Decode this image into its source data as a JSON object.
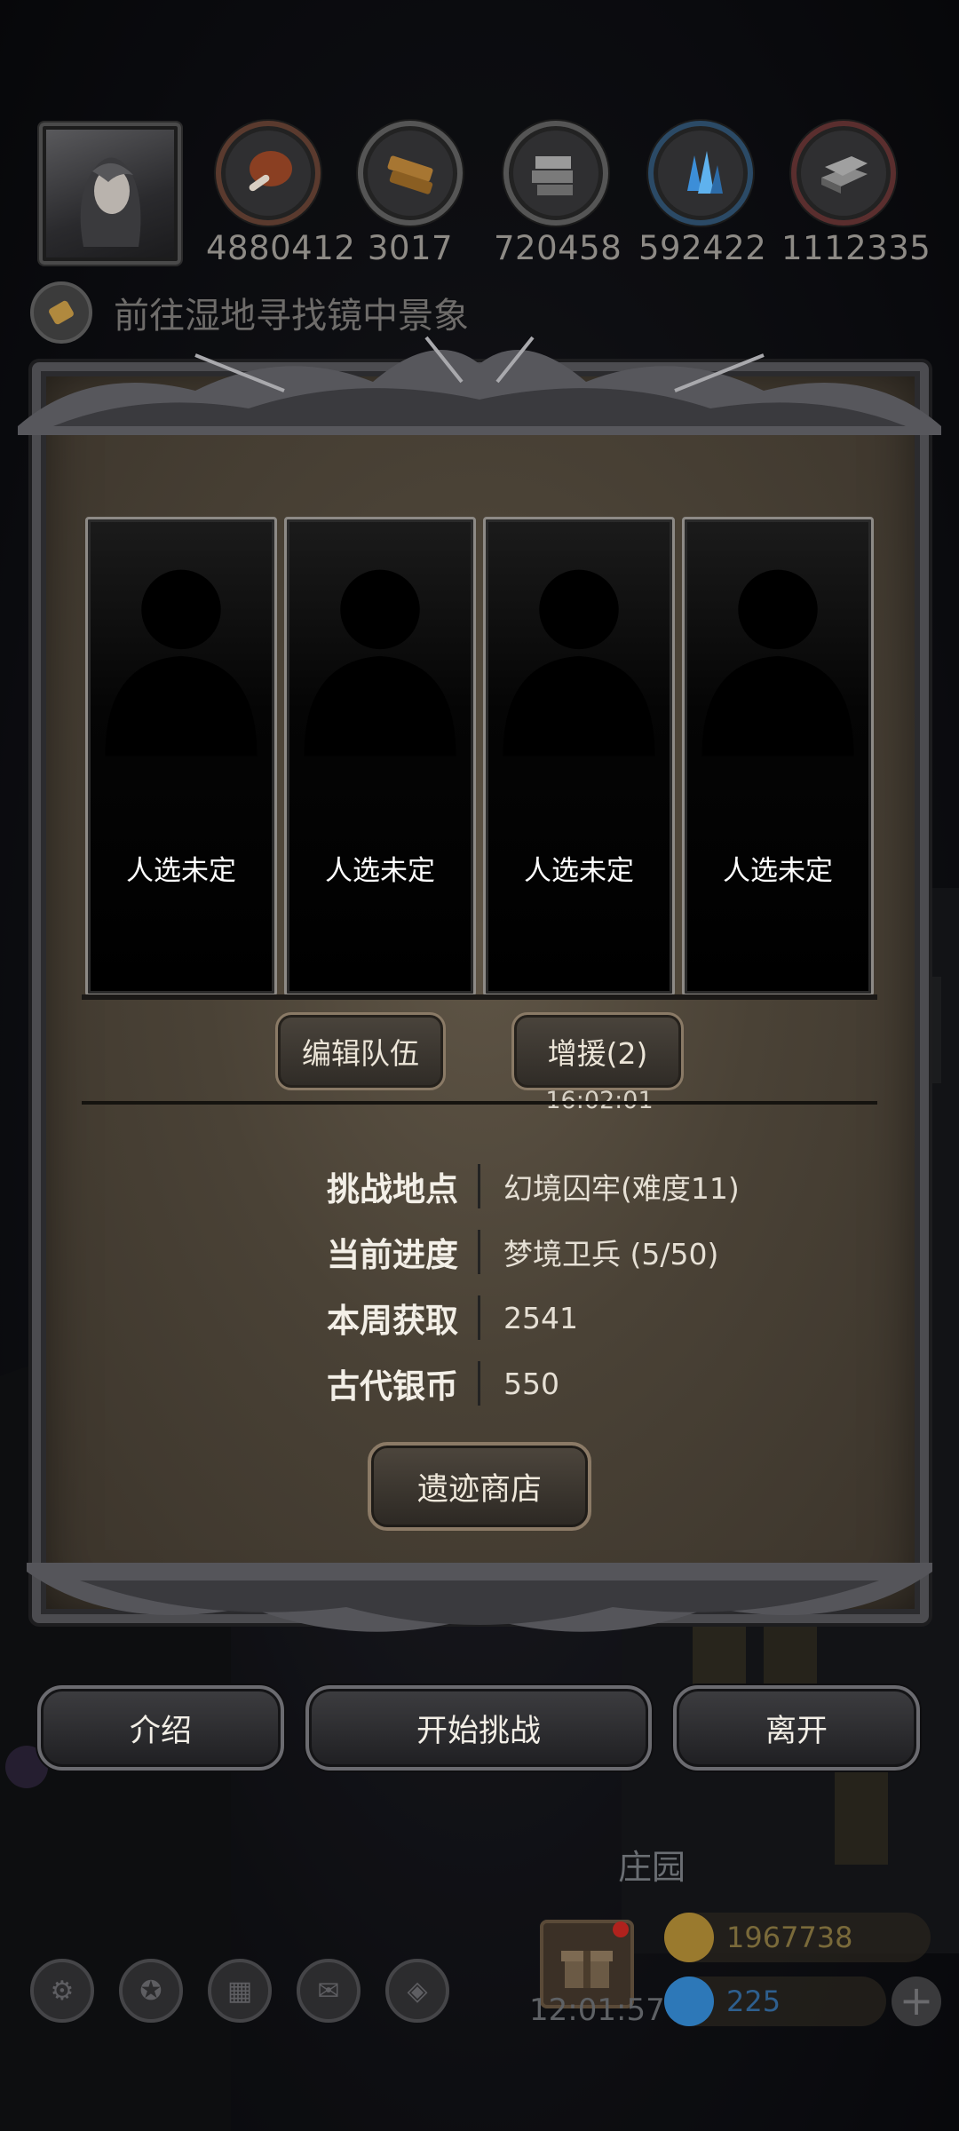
{
  "resources": [
    {
      "icon": "meat-icon",
      "value": "4880412"
    },
    {
      "icon": "wood-icon",
      "value": "3017"
    },
    {
      "icon": "stone-icon",
      "value": "720458"
    },
    {
      "icon": "crystal-icon",
      "value": "592422"
    },
    {
      "icon": "iron-icon",
      "value": "1112335"
    }
  ],
  "quest": {
    "text": "前往湿地寻找镜中景象"
  },
  "team": {
    "slots": [
      {
        "label": "人选未定"
      },
      {
        "label": "人选未定"
      },
      {
        "label": "人选未定"
      },
      {
        "label": "人选未定"
      }
    ],
    "edit_label": "编辑队伍",
    "reinforce_label": "增援(2)",
    "timer": "16:02:01"
  },
  "info": {
    "location_key": "挑战地点",
    "location_value": "幻境囚牢(难度11)",
    "progress_key": "当前进度",
    "progress_value": "梦境卫兵 (5/50)",
    "weekly_key": "本周获取",
    "weekly_value": "2541",
    "coin_key": "古代银币",
    "coin_value": "550"
  },
  "shop_label": "遗迹商店",
  "actions": {
    "intro": "介绍",
    "start": "开始挑战",
    "leave": "离开"
  },
  "hud": {
    "manor": "庄园",
    "clock": "12:01:57",
    "gold": "1967738",
    "gems": "225",
    "plus": "+"
  },
  "colors": {
    "panel": "#4a4236",
    "frame": "#4c4c50",
    "gold": "#9a7a2e",
    "gem": "#2d78b8"
  }
}
